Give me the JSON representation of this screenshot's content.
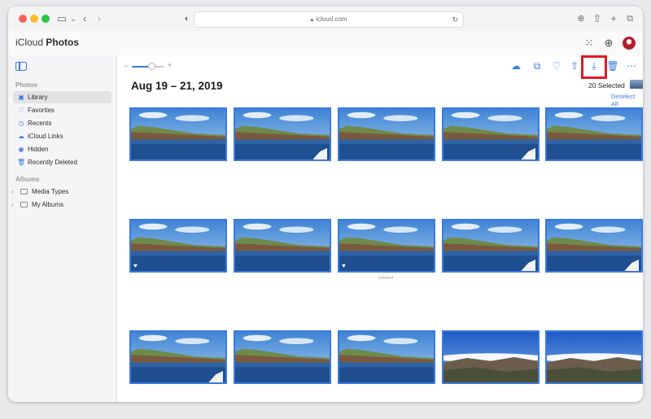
{
  "browser": {
    "url": "icloud.com"
  },
  "app": {
    "brand_prefix": "iCloud",
    "brand_name": "Photos"
  },
  "sidebar": {
    "photos_header": "Photos",
    "items": [
      {
        "label": "Library",
        "icon": "library-icon",
        "active": true
      },
      {
        "label": "Favorites",
        "icon": "heart-icon",
        "active": false
      },
      {
        "label": "Recents",
        "icon": "clock-icon",
        "active": false
      },
      {
        "label": "iCloud Links",
        "icon": "cloud-icon",
        "active": false
      },
      {
        "label": "Hidden",
        "icon": "eye-icon",
        "active": false
      },
      {
        "label": "Recently Deleted",
        "icon": "trash-icon",
        "active": false
      }
    ],
    "albums_header": "Albums",
    "albums": [
      {
        "label": "Media Types",
        "icon": "folder-icon"
      },
      {
        "label": "My Albums",
        "icon": "folder-icon"
      }
    ]
  },
  "toolbar": {
    "zoom_minus": "−",
    "zoom_plus": "+",
    "zoom_level": 0.6,
    "icons": [
      "upload-icon",
      "add-to-album-icon",
      "favorite-icon",
      "share-icon",
      "download-icon",
      "delete-icon",
      "more-icon"
    ],
    "highlighted_icon": "download-icon"
  },
  "main": {
    "date_range": "Aug 19 – 21, 2019",
    "selected_count": "20 Selected",
    "deselect_label": "Deselect All",
    "row2_caption": "Unlisted"
  },
  "colors": {
    "accent": "#3b7ae0",
    "highlight": "#e01b24"
  },
  "photos": [
    {
      "scene": "coast",
      "favorite": false,
      "boat": false
    },
    {
      "scene": "coast",
      "favorite": false,
      "boat": true
    },
    {
      "scene": "coast",
      "favorite": false,
      "boat": false
    },
    {
      "scene": "coast",
      "favorite": false,
      "boat": true
    },
    {
      "scene": "coast",
      "favorite": false,
      "boat": false
    },
    {
      "scene": "coast",
      "favorite": true,
      "boat": false
    },
    {
      "scene": "coast",
      "favorite": false,
      "boat": false
    },
    {
      "scene": "coast",
      "favorite": true,
      "boat": false
    },
    {
      "scene": "coast",
      "favorite": false,
      "boat": true
    },
    {
      "scene": "coast",
      "favorite": false,
      "boat": true
    },
    {
      "scene": "coast",
      "favorite": false,
      "boat": true
    },
    {
      "scene": "coast",
      "favorite": false,
      "boat": false
    },
    {
      "scene": "coast",
      "favorite": false,
      "boat": false
    },
    {
      "scene": "mountain",
      "favorite": false,
      "boat": false
    },
    {
      "scene": "mountain",
      "favorite": false,
      "boat": false
    }
  ]
}
